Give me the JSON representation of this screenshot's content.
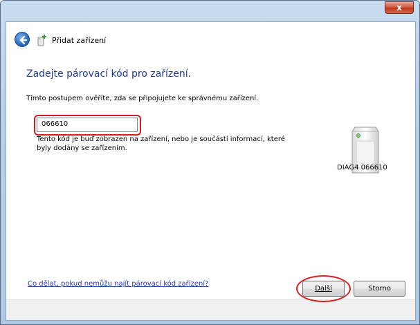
{
  "window": {
    "title": "Přidat zařízení",
    "close_label": "x"
  },
  "main": {
    "heading": "Zadejte párovací kód pro zařízení.",
    "description": "Tímto postupem ověříte, zda se připojujete ke správnému zařízení.",
    "code_value": "066610",
    "hint": "Tento kód je buď zobrazen na zařízení, nebo je součástí informací, které byly dodány se zařízením.",
    "device_name": "DIAG4 066610",
    "help_link": "Co dělat, pokud nemůžu najít párovací kód zařízení?"
  },
  "buttons": {
    "next_label": "Další",
    "cancel_label": "Storno"
  },
  "icons": {
    "back": "back-arrow-icon",
    "add_device": "add-device-icon",
    "device": "device-tower-icon"
  },
  "colors": {
    "heading": "#1e3b9e",
    "link": "#1a3fae",
    "highlight": "#d81b1b"
  }
}
